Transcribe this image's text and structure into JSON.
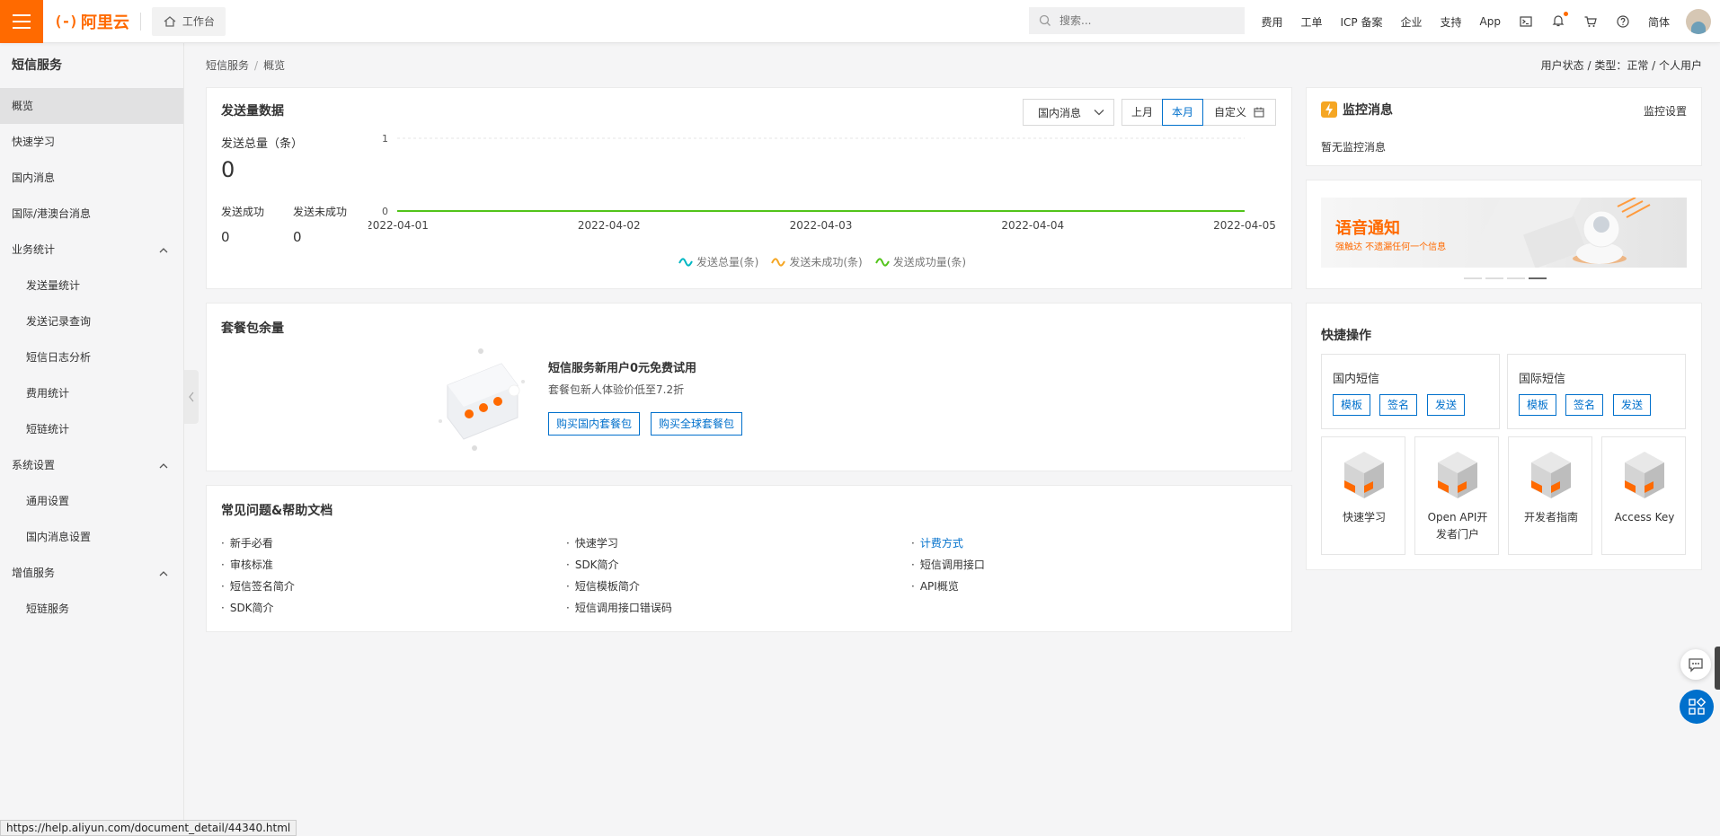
{
  "topbar": {
    "brand": "阿里云",
    "logo_glyph": "(-)",
    "workbench": "工作台",
    "search_placeholder": "搜索...",
    "nav": [
      "费用",
      "工单",
      "ICP 备案",
      "企业",
      "支持",
      "App"
    ],
    "lang": "简体"
  },
  "sidebar": {
    "title": "短信服务",
    "items": [
      {
        "label": "概览"
      },
      {
        "label": "快速学习"
      },
      {
        "label": "国内消息"
      },
      {
        "label": "国际/港澳台消息"
      },
      {
        "label": "业务统计"
      },
      {
        "label": "发送量统计"
      },
      {
        "label": "发送记录查询"
      },
      {
        "label": "短信日志分析"
      },
      {
        "label": "费用统计"
      },
      {
        "label": "短链统计"
      },
      {
        "label": "系统设置"
      },
      {
        "label": "通用设置"
      },
      {
        "label": "国内消息设置"
      },
      {
        "label": "增值服务"
      },
      {
        "label": "短链服务"
      }
    ]
  },
  "breadcrumb": {
    "root": "短信服务",
    "sep": "/",
    "current": "概览"
  },
  "user_status": "用户状态 / 类型：正常 / 个人用户",
  "send": {
    "title": "发送量数据",
    "region": "国内消息",
    "ranges": [
      "上月",
      "本月",
      "自定义"
    ],
    "total_label": "发送总量（条）",
    "total_value": "0",
    "success_label": "发送成功",
    "success_value": "0",
    "fail_label": "发送未成功",
    "fail_value": "0"
  },
  "chart_data": {
    "type": "line",
    "x": [
      "2022-04-01",
      "2022-04-02",
      "2022-04-03",
      "2022-04-04",
      "2022-04-05"
    ],
    "yticks": [
      "1",
      "0"
    ],
    "ylim": [
      0,
      1
    ],
    "series": [
      {
        "name": "发送总量(条)",
        "values": [
          0,
          0,
          0,
          0,
          0
        ],
        "color": "#00b7c3"
      },
      {
        "name": "发送未成功(条)",
        "values": [
          0,
          0,
          0,
          0,
          0
        ],
        "color": "#f5a623"
      },
      {
        "name": "发送成功量(条)",
        "values": [
          0,
          0,
          0,
          0,
          0
        ],
        "color": "#52c41a"
      }
    ],
    "legend_position": "bottom"
  },
  "package": {
    "title": "套餐包余量",
    "headline": "短信服务新用户0元免费试用",
    "sub": "套餐包新人体验价低至7.2折",
    "buy_domestic": "购买国内套餐包",
    "buy_global": "购买全球套餐包"
  },
  "faq": {
    "title": "常见问题&帮助文档",
    "col1": [
      "新手必看",
      "审核标准",
      "短信签名简介",
      "SDK简介"
    ],
    "col2": [
      "快速学习",
      "SDK简介",
      "短信模板简介",
      "短信调用接口错误码"
    ],
    "col3": [
      "计费方式",
      "短信调用接口",
      "API概览"
    ]
  },
  "monitor": {
    "title": "监控消息",
    "settings": "监控设置",
    "empty": "暂无监控消息"
  },
  "banner": {
    "title": "语音通知",
    "sub": "强触达 不遗漏任何一个信息"
  },
  "quick": {
    "title": "快捷操作",
    "domestic": {
      "title": "国内短信",
      "buttons": [
        "模板",
        "签名",
        "发送"
      ]
    },
    "international": {
      "title": "国际短信",
      "buttons": [
        "模板",
        "签名",
        "发送"
      ]
    },
    "tiles": [
      "快速学习",
      "Open API开发者门户",
      "开发者指南",
      "Access Key"
    ]
  },
  "status_url": "https://help.aliyun.com/document_detail/44340.html",
  "colors": {
    "brand": "#ff6a00",
    "link": "#0070cc"
  }
}
